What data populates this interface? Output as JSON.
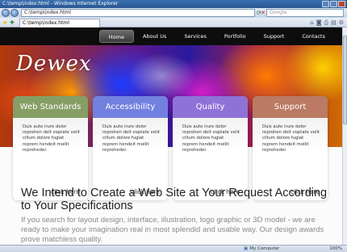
{
  "browser": {
    "window_title": "C:\\temp\\index.html - Windows Internet Explorer",
    "address": "C:\\temp\\index.html",
    "search_placeholder": "Google",
    "tab_label": "C:\\temp\\index.html",
    "icons": {
      "back": "back-arrow-icon",
      "forward": "forward-arrow-icon",
      "refresh": "refresh-icon",
      "stop": "stop-icon",
      "favorites": "star-icon"
    },
    "status": {
      "zone": "My Computer",
      "zoom": "100%"
    }
  },
  "site": {
    "logo": "Dewex",
    "nav": [
      "Home",
      "About Us",
      "Services",
      "Portfolio",
      "Support",
      "Contacts"
    ],
    "active_nav": "Home",
    "boxes": [
      {
        "title": "Web Standards",
        "text": "Duis aute irure dolor reprehen deit voptate velit cillum dolore fugiat reprem hendeit mollit repreheder.",
        "link": "click here"
      },
      {
        "title": "Accessibility",
        "text": "Duis aute irure dolor reprehen deit voptate velit cillum dolore fugiat reprem hendeit mollit repreheder.",
        "link": "click here"
      },
      {
        "title": "Quality",
        "text": "Duis aute irure dolor reprehen deit voptate velit cillum dolore fugiat reprem hendeit mollit repreheder.",
        "link": "click here"
      },
      {
        "title": "Support",
        "text": "Duis aute irure dolor reprehen deit voptate velit cillum dolore fugiat reprem hendeit mollit repreheder.",
        "link": "click here"
      }
    ],
    "headline": "We Intend to Create a Web Site at Your Request According to Your Specifications",
    "paragraph": "If you search for layout design, interface, illustration, logo graphic or 3D model - we are ready to make your imagination real in most splendid and usable way. Our design awards prove matchless quality."
  }
}
